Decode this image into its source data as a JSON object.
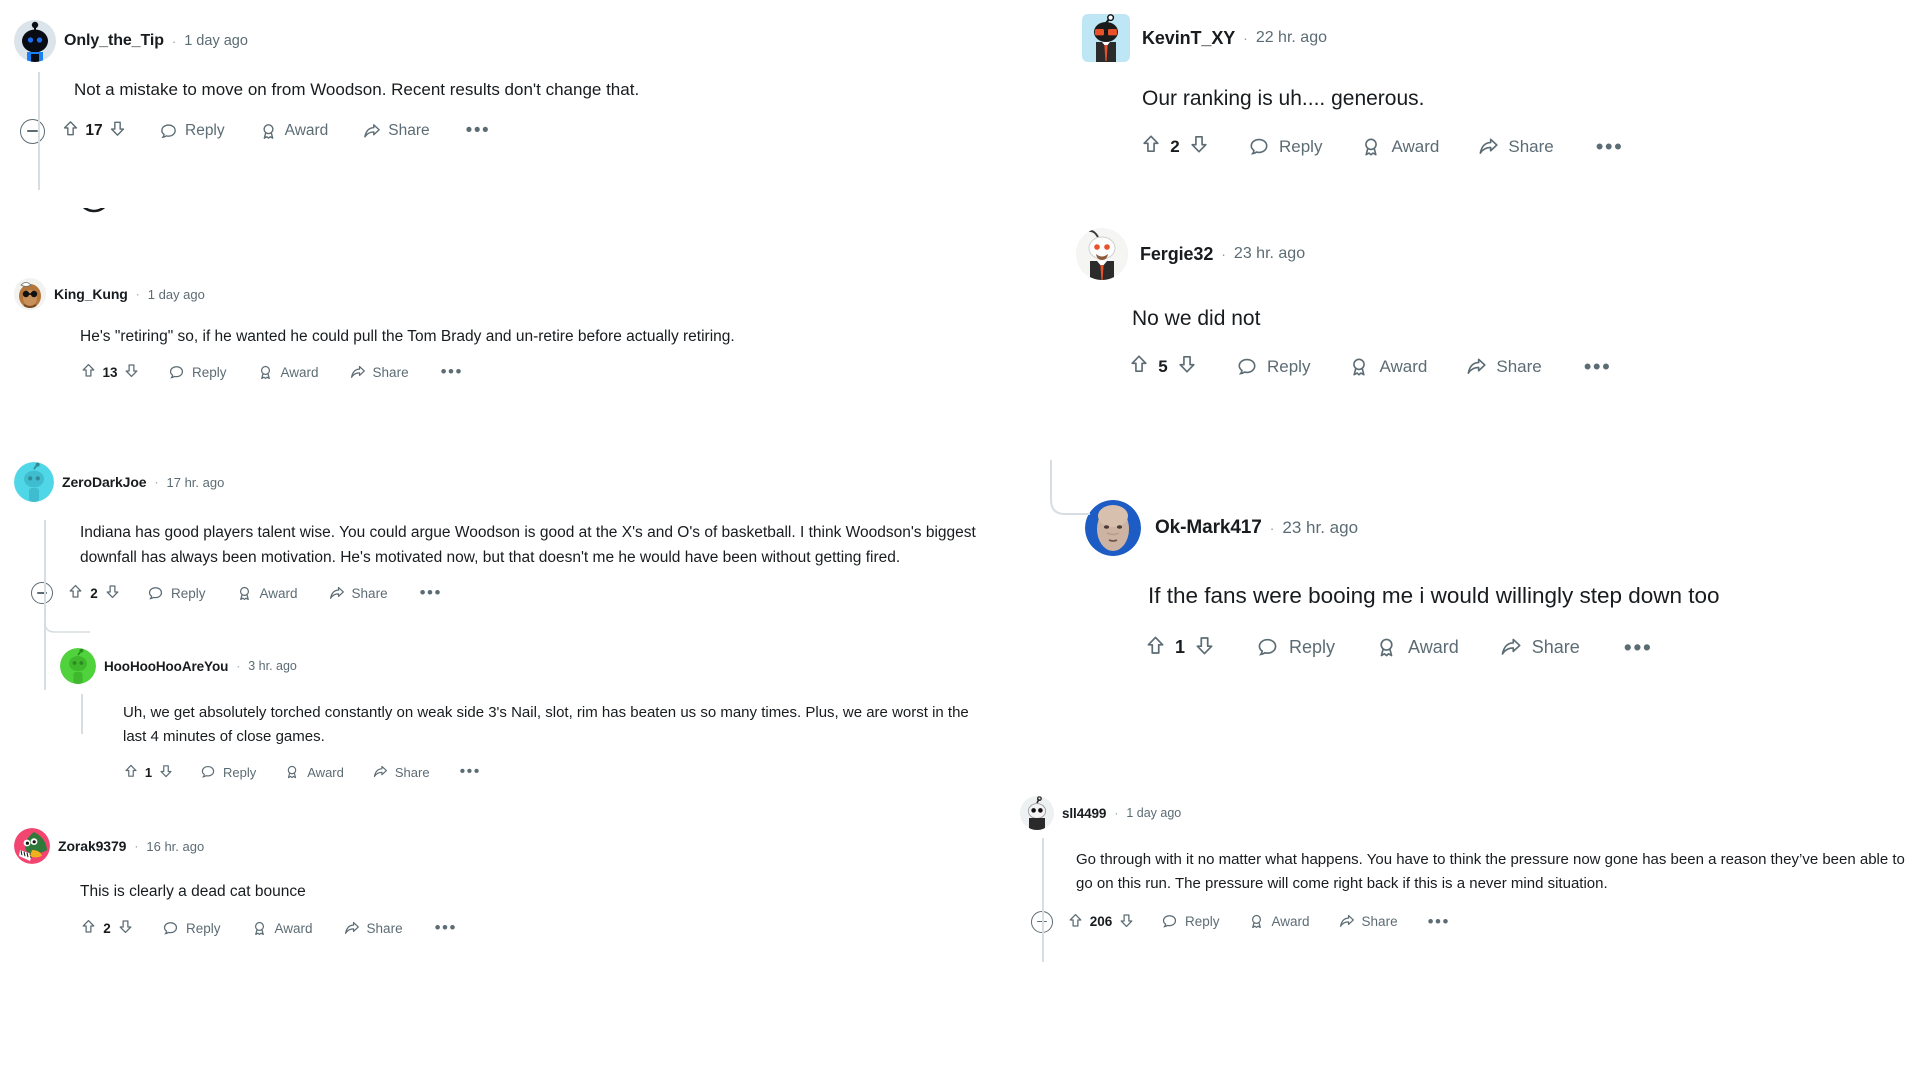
{
  "app": {
    "name": "reddit-comments",
    "theme": "light"
  },
  "colors": {
    "text": "#181c1f",
    "muted": "#5c6c74",
    "rail": "#d7dde1",
    "background": "#ffffff"
  },
  "labels": {
    "reply": "Reply",
    "award": "Award",
    "share": "Share",
    "more": "•••",
    "separator": "·",
    "upvote_icon": "upvote-arrow-icon",
    "downvote_icon": "downvote-arrow-icon",
    "reply_icon": "speech-bubble-icon",
    "award_icon": "award-badge-icon",
    "share_icon": "share-arrow-icon",
    "more_icon": "overflow-menu-icon",
    "collapse_icon": "collapse-minus-icon"
  },
  "left_column": {
    "comments": [
      {
        "id": "only-the-tip",
        "username": "Only_the_Tip",
        "timestamp": "1 day ago",
        "body": "Not a mistake to move on from Woodson. Recent results don't change that.",
        "score": "17",
        "collapsible": true,
        "avatar": "snoo-blue-avatar"
      },
      {
        "id": "king-kung",
        "username": "King_Kung",
        "timestamp": "1 day ago",
        "body": "He's \"retiring\" so, if he wanted he could pull the Tom Brady and un-retire before actually retiring.",
        "score": "13",
        "collapsible": false,
        "avatar": "monkey-sunglasses-avatar"
      },
      {
        "id": "zerodarkjoe",
        "username": "ZeroDarkJoe",
        "timestamp": "17 hr. ago",
        "body": "Indiana has good players talent wise. You could argue Woodson is good at the X's and O's of basketball. I think Woodson's biggest downfall has always been motivation. He's motivated now, but that doesn't me he would have been without getting fired.",
        "score": "2",
        "collapsible": true,
        "avatar": "snoo-cyan-avatar"
      },
      {
        "id": "hoohoohooareyou",
        "username": "HooHooHooAreYou",
        "timestamp": "3 hr. ago",
        "body": "Uh, we get absolutely torched constantly on weak side 3's Nail, slot, rim has beaten us so many times. Plus, we are worst in the last 4 minutes of close games.",
        "score": "1",
        "collapsible": false,
        "avatar": "snoo-green-avatar",
        "nested": true
      },
      {
        "id": "zorak9379",
        "username": "Zorak9379",
        "timestamp": "16 hr. ago",
        "body": "This is clearly a dead cat bounce",
        "score": "2",
        "collapsible": false,
        "avatar": "zorak-pink-avatar"
      }
    ]
  },
  "right_column": {
    "comments": [
      {
        "id": "kevint-xy",
        "username": "KevinT_XY",
        "timestamp": "22 hr. ago",
        "body": "Our ranking is uh.... generous.",
        "score": "2",
        "collapsible": false,
        "avatar": "snoo-beard-glasses-avatar"
      },
      {
        "id": "fergie32",
        "username": "Fergie32",
        "timestamp": "23 hr. ago",
        "body": "No we did not",
        "score": "5",
        "collapsible": false,
        "avatar": "snoo-suit-tie-avatar"
      },
      {
        "id": "ok-mark417",
        "username": "Ok-Mark417",
        "timestamp": "23 hr. ago",
        "body": "If the fans were booing me i would willingly step down too",
        "score": "1",
        "collapsible": false,
        "avatar": "photo-face-blue-avatar",
        "nested": true
      },
      {
        "id": "sll4499",
        "username": "sll4499",
        "timestamp": "1 day ago",
        "body": "Go through with it no matter what happens. You have to think the pressure now gone has been a reason they’ve been able to go on this run. The pressure will come right back if this is a never mind situation.",
        "score": "206",
        "collapsible": true,
        "avatar": "snoo-dark-hood-avatar"
      }
    ]
  }
}
